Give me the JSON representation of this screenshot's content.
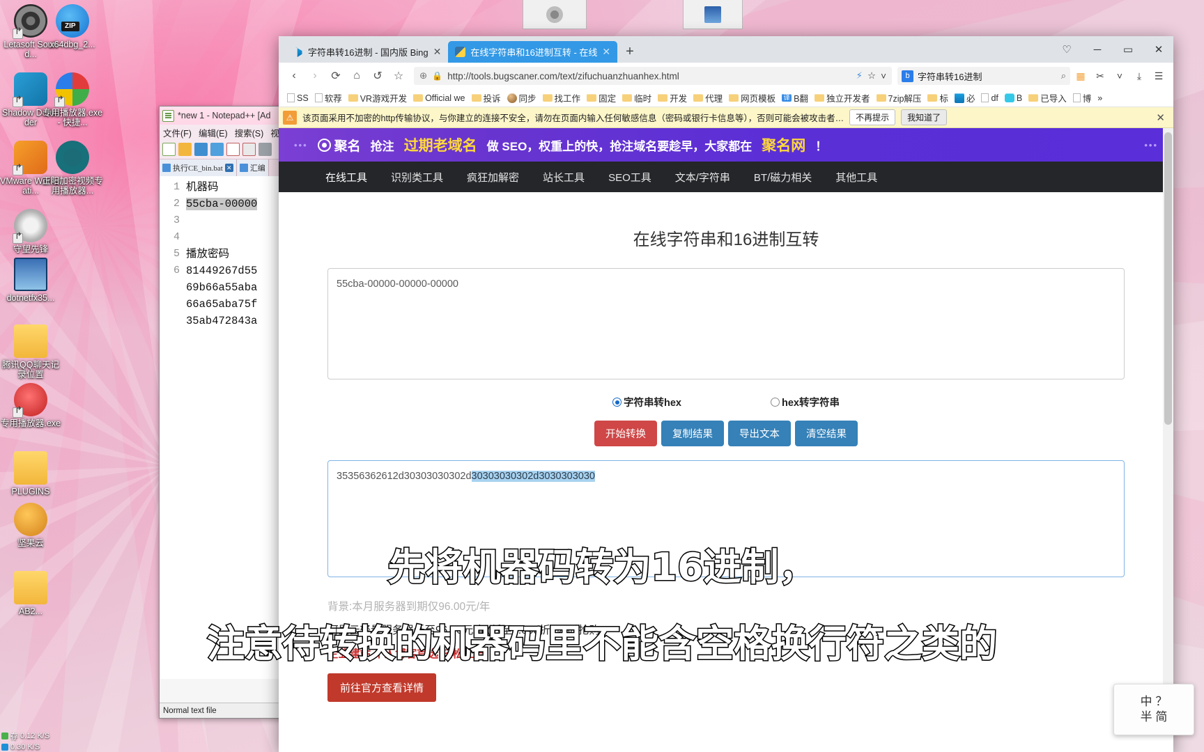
{
  "desktop": {
    "icons": [
      {
        "label": "Letasoft Sound...",
        "icon": "speaker-icon",
        "color": "#3a3a3a"
      },
      {
        "label": "x64dbg_2...",
        "icon": "zip-icon",
        "color": "#2196f3"
      },
      {
        "label": "Shadow Defender",
        "icon": "shield-icon",
        "color": "#2a9fd6"
      },
      {
        "label": "专用播放器.exe - 快捷...",
        "icon": "media-player-icon",
        "color": "#f0a030"
      },
      {
        "label": "VMware Workstati...",
        "icon": "vmware-icon",
        "color": "#f08a24"
      },
      {
        "label": "正阳加密视频专用播放器...",
        "icon": "gear-icon",
        "color": "#17707a"
      },
      {
        "label": "守望先锋",
        "icon": "overwatch-icon",
        "color": "#c9c9c9"
      },
      {
        "label": "dotnetfx35...",
        "icon": "installer-icon",
        "color": "#2b5faa"
      },
      {
        "label": "腾讯QQ聊天记录位置",
        "icon": "folder-icon",
        "color": "#f7c353"
      },
      {
        "label": "专用播放器.exe",
        "icon": "media-player-icon",
        "color": "#d04a4a"
      },
      {
        "label": "PLUGINS",
        "icon": "folder-icon",
        "color": "#f7c353"
      },
      {
        "label": "坚果云",
        "icon": "nut-cloud-icon",
        "color": "#f0a030"
      },
      {
        "label": "AB2...",
        "icon": "folder-icon",
        "color": "#f7c353"
      }
    ],
    "netstat": {
      "up": "0.12 K/S",
      "down": "0.30 K/S",
      "label": "存"
    }
  },
  "notepad": {
    "title": "*new 1 - Notepad++ [Ad",
    "menus": [
      "文件(F)",
      "编辑(E)",
      "搜索(S)",
      "视"
    ],
    "tabs": [
      {
        "label": "执行CE_bin.bat",
        "close": "✕"
      },
      {
        "label": "汇编",
        "close": ""
      }
    ],
    "lines": [
      "机器码",
      "55cba-00000",
      "",
      "",
      "播放密码",
      "81449267d55"
    ],
    "extra_lines": [
      "69b66a55aba",
      "66a65aba75f",
      "35ab472843a"
    ],
    "selected_line": "55cba-00000",
    "status": "Normal text file"
  },
  "browser": {
    "tabs": [
      {
        "title": "字符串转16进制 - 国内版 Bing",
        "active": false,
        "favicon": "bing-icon",
        "close": "✕"
      },
      {
        "title": "在线字符串和16进制互转 - 在线",
        "active": true,
        "favicon": "python-icon",
        "close": "✕"
      }
    ],
    "new_tab_label": "+",
    "window_buttons": {
      "heart": "♡",
      "minimize": "─",
      "maximize": "▭",
      "close": "✕"
    },
    "nav": {
      "back": "‹",
      "forward": "›",
      "reload": "⟳",
      "home": "⌂",
      "history": "↺",
      "favorite": "☆",
      "shield": "⊕",
      "lock": "🔒",
      "url": "http://tools.bugscaner.com/text/zifuchuanzhuanhex.html",
      "lightning": "⚡",
      "star": "☆",
      "chevron": "˅"
    },
    "search": {
      "value": "字符串转16进制",
      "icon": "bing-icon",
      "search_icon": "⌕"
    },
    "toolbar_right": {
      "grid": "▦",
      "scissors": "✂",
      "chevron": "˅",
      "download": "⤓",
      "menu": "☰"
    },
    "bookmarks": [
      {
        "label": "SS",
        "type": "page"
      },
      {
        "label": "软荐",
        "type": "page"
      },
      {
        "label": "VR游戏开发",
        "type": "folder"
      },
      {
        "label": "Official we",
        "type": "folder"
      },
      {
        "label": "投诉",
        "type": "folder"
      },
      {
        "label": "同步",
        "type": "sphere"
      },
      {
        "label": "找工作",
        "type": "folder"
      },
      {
        "label": "固定",
        "type": "folder"
      },
      {
        "label": "临时",
        "type": "folder"
      },
      {
        "label": "开发",
        "type": "folder"
      },
      {
        "label": "代理",
        "type": "folder"
      },
      {
        "label": "网页模板",
        "type": "folder"
      },
      {
        "label": "B翻",
        "type": "translate"
      },
      {
        "label": "独立开发者",
        "type": "folder"
      },
      {
        "label": "7zip解压",
        "type": "folder"
      },
      {
        "label": "标",
        "type": "folder"
      },
      {
        "label": "必",
        "type": "bing"
      },
      {
        "label": "df",
        "type": "page"
      },
      {
        "label": "B",
        "type": "bili"
      },
      {
        "label": "已导入",
        "type": "folder"
      },
      {
        "label": "博",
        "type": "page"
      }
    ],
    "bookmarks_overflow": "»",
    "warning": {
      "text": "该页面采用不加密的http传输协议，与你建立的连接不安全，请勿在页面内输入任何敏感信息（密码或银行卡信息等），否则可能会被攻击者…",
      "btn_dismiss": "不再提示",
      "btn_ok": "我知道了",
      "close": "✕"
    }
  },
  "site": {
    "ad_banner": {
      "brand": "聚名",
      "dots_left": "•••",
      "dots_right": "•••",
      "text_parts": [
        "抢注",
        "过期老域名",
        "做 SEO，权重上的快，抢注域名要趁早，大家都在",
        "聚名网",
        "！"
      ]
    },
    "nav": [
      "在线工具",
      "识别类工具",
      "疯狂加解密",
      "站长工具",
      "SEO工具",
      "文本/字符串",
      "BT/磁力相关",
      "其他工具"
    ],
    "page_title": "在线字符串和16进制互转",
    "input": {
      "value": "55cba-00000-00000-00000",
      "placeholder": ""
    },
    "radios": [
      {
        "label": "字符串转hex",
        "checked": true
      },
      {
        "label": "hex转字符串",
        "checked": false
      }
    ],
    "buttons": [
      {
        "label": "开始转换",
        "style": "red"
      },
      {
        "label": "复制结果",
        "style": "blue"
      },
      {
        "label": "导出文本",
        "style": "blue"
      },
      {
        "label": "清空结果",
        "style": "blue"
      }
    ],
    "output": {
      "plain": "35356362612d30303030302d",
      "selected": "30303030302d3030303030"
    },
    "footer_ads": {
      "hidden_line": "背景:本月服务器到期仅96.00元/年",
      "line1": "阿里云轻量服务器低至96.00元/年(低至0.058折),限时抢购",
      "line2": "企业建站,个人博客首选,轻松上云!",
      "button": "前往官方查看详情"
    }
  },
  "subtitles": {
    "line1": "先将机器码转为16进制，",
    "line2": "注意待转换的机器码里不能含空格换行符之类的"
  },
  "ime": {
    "line1": "中 ？",
    "line2": "半 简"
  }
}
